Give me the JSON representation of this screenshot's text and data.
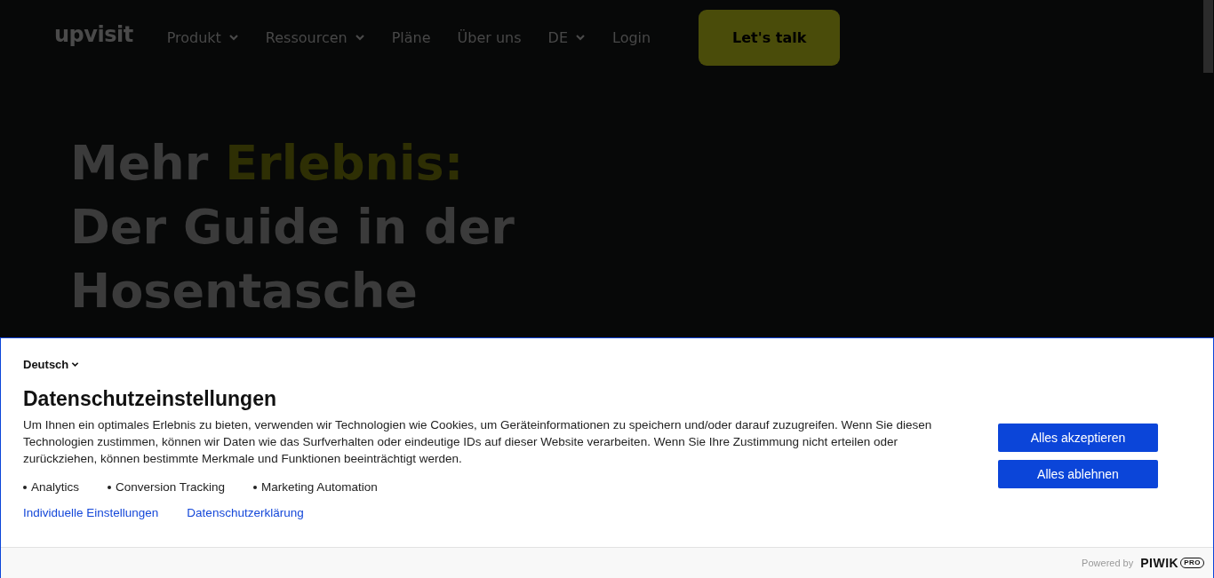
{
  "header": {
    "logo": "upvisit",
    "nav": [
      {
        "label": "Produkt",
        "dropdown": true
      },
      {
        "label": "Ressourcen",
        "dropdown": true
      },
      {
        "label": "Pläne",
        "dropdown": false
      },
      {
        "label": "Über uns",
        "dropdown": false
      },
      {
        "label": "DE",
        "dropdown": true
      },
      {
        "label": "Login",
        "dropdown": false
      }
    ],
    "cta": "Let's talk"
  },
  "hero": {
    "lead": "Mehr",
    "highlight": "Erlebnis:",
    "lines": [
      "Der Guide in der",
      "Hosentasche"
    ]
  },
  "consent": {
    "language": "Deutsch",
    "title": "Datenschutzeinstellungen",
    "text": "Um Ihnen ein optimales Erlebnis zu bieten, verwenden wir Technologien wie Cookies, um Geräteinformationen zu speichern und/oder darauf zuzugreifen. Wenn Sie diesen Technologien zustimmen, können wir Daten wie das Surfverhalten oder eindeutige IDs auf dieser Website verarbeiten. Wenn Sie Ihre Zustimmung nicht erteilen oder zurückziehen, können bestimmte Merkmale und Funktionen beeinträchtigt werden.",
    "purposes": [
      "Analytics",
      "Conversion Tracking",
      "Marketing Automation"
    ],
    "links": [
      "Individuelle Einstellungen",
      "Datenschutzerklärung"
    ],
    "buttons": [
      "Alles akzeptieren",
      "Alles ablehnen"
    ],
    "footer": {
      "powered_by": "Powered by",
      "brand": "PIWIK",
      "brand_badge": "PRO"
    }
  }
}
